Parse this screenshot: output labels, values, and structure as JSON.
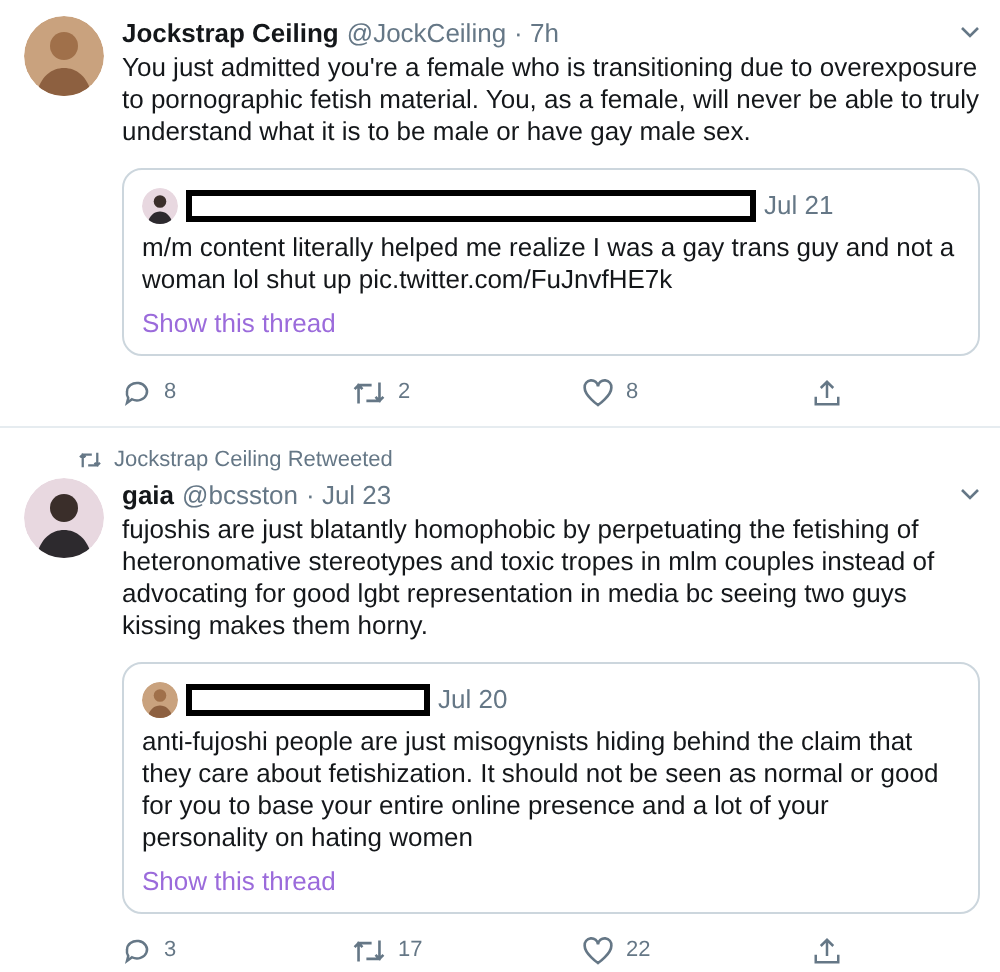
{
  "tweets": [
    {
      "name": "Jockstrap Ceiling",
      "handle": "@JockCeiling",
      "time": "· 7h",
      "text": "You just admitted you're a female who is transitioning due to overexposure to pornographic fetish material. You, as a female, will never be able to truly understand what it is to be male or have gay male sex.",
      "quote": {
        "date": "Jul 21",
        "text": "m/m content literally helped me realize I was a gay trans guy and not a woman lol shut up pic.twitter.com/FuJnvfHE7k",
        "link": "Show this thread"
      },
      "counts": {
        "replies": "8",
        "retweets": "2",
        "likes": "8"
      }
    },
    {
      "retweeted_by": "Jockstrap Ceiling Retweeted",
      "name": "gaia",
      "handle": "@bcsston",
      "time": "· Jul 23",
      "text": "fujoshis are just blatantly homophobic by perpetuating the fetishing of heteronomative stereotypes and toxic tropes in mlm couples instead of advocating for good lgbt representation in media bc seeing two guys kissing makes them horny.",
      "quote": {
        "date": "Jul 20",
        "text": "anti-fujoshi people are just misogynists hiding behind the claim that they care about fetishization. It should not be seen as normal or good for you to base your entire online presence and a lot of your personality on hating women",
        "link": "Show this thread"
      },
      "counts": {
        "replies": "3",
        "retweets": "17",
        "likes": "22"
      }
    }
  ]
}
